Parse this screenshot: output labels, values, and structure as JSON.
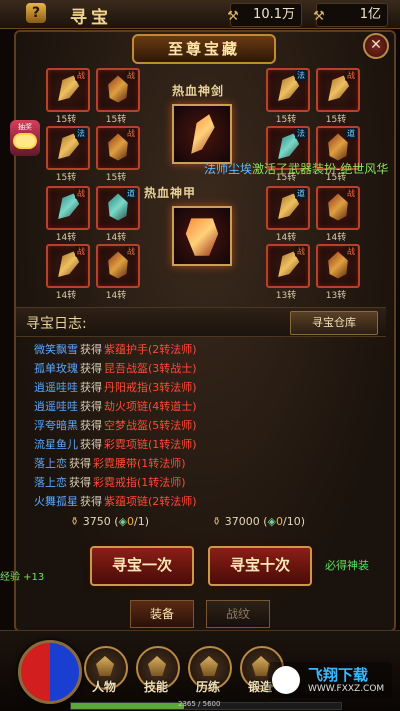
{
  "topbar": {
    "help_label": "?",
    "title": "寻宝",
    "currency1": "10.1万",
    "currency2": "1亿",
    "currency1_icon": "coin-icon",
    "currency2_icon": "gold-icon"
  },
  "panel": {
    "banner": "至尊宝藏",
    "close_label": "✕"
  },
  "features": {
    "weapon_label": "热血神剑",
    "armor_label": "热血神甲"
  },
  "slots": [
    {
      "level": "15转",
      "tag": "战"
    },
    {
      "level": "15转",
      "tag": "战"
    },
    {
      "level": "15转",
      "tag": "法"
    },
    {
      "level": "15转",
      "tag": "战"
    },
    {
      "level": "15转",
      "tag": "法"
    },
    {
      "level": "15转",
      "tag": "战"
    },
    {
      "level": "15转",
      "tag": "法"
    },
    {
      "level": "15转",
      "tag": "道"
    },
    {
      "level": "14转",
      "tag": "战"
    },
    {
      "level": "14转",
      "tag": "道"
    },
    {
      "level": "14转",
      "tag": "道"
    },
    {
      "level": "14转",
      "tag": "战"
    },
    {
      "level": "14转",
      "tag": "战"
    },
    {
      "level": "14转",
      "tag": "战"
    },
    {
      "level": "13转",
      "tag": "战"
    },
    {
      "level": "13转",
      "tag": "战"
    }
  ],
  "notice": {
    "who": "法师尘埃",
    "msg": "激活了武器装扮-绝世风华"
  },
  "side_badge": {
    "label": "抽奖"
  },
  "log": {
    "title": "寻宝日志:",
    "warehouse": "寻宝仓库",
    "rows": [
      {
        "name": "微笑飘雪",
        "verb": "获得",
        "item": "紫蕴护手(2转法师)"
      },
      {
        "name": "孤单玫瑰",
        "verb": "获得",
        "item": "昆吾战盔(3转战士)"
      },
      {
        "name": "逍遥哇哇",
        "verb": "获得",
        "item": "丹阳戒指(3转法师)"
      },
      {
        "name": "逍遥哇哇",
        "verb": "获得",
        "item": "劫火项链(4转道士)"
      },
      {
        "name": "浮夸暗黑",
        "verb": "获得",
        "item": "空梦战盔(5转法师)"
      },
      {
        "name": "流星鱼儿",
        "verb": "获得",
        "item": "彩霓项链(1转法师)"
      },
      {
        "name": "落上恋",
        "verb": "获得",
        "item": "彩霓腰带(1转法师)"
      },
      {
        "name": "落上恋",
        "verb": "获得",
        "item": "彩霓戒指(1转法师)"
      },
      {
        "name": "火舞孤星",
        "verb": "获得",
        "item": "紫蕴项链(2转法师)"
      }
    ]
  },
  "costs": [
    {
      "bag": "3750",
      "have": "0",
      "need": "/1"
    },
    {
      "bag": "37000",
      "have": "0",
      "need": "/10"
    }
  ],
  "buttons": {
    "once": "寻宝一次",
    "ten": "寻宝十次",
    "get_god": "必得神装"
  },
  "exp_gain": "经验 +13",
  "tabs": {
    "equip": "装备",
    "battle": "战纹"
  },
  "nav": [
    {
      "label": "人物"
    },
    {
      "label": "技能"
    },
    {
      "label": "历练"
    },
    {
      "label": "锻造"
    }
  ],
  "watermark": {
    "name": "飞翔下载",
    "url": "WWW.FXXZ.COM"
  },
  "expbar": {
    "text": "2365 / 5600",
    "fill": 0.42
  }
}
